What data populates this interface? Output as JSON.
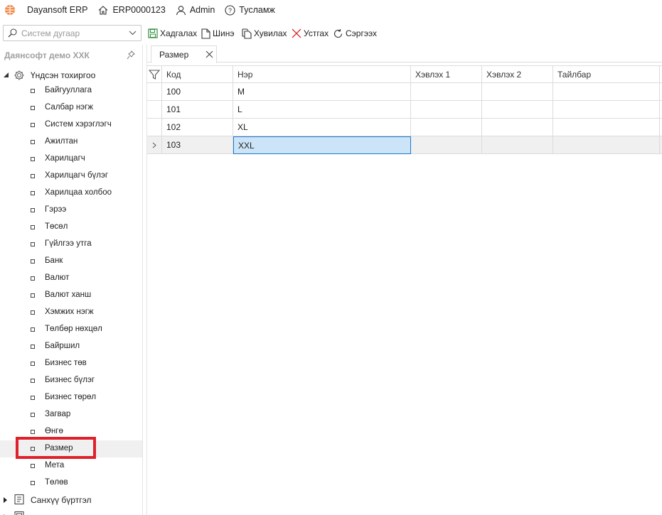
{
  "topbar": {
    "app_name": "Dayansoft ERP",
    "company_code": "ERP0000123",
    "user": "Admin",
    "help": "Тусламж"
  },
  "toolbar": {
    "search_placeholder": "Систем дугаар",
    "save": "Хадгалах",
    "new": "Шинэ",
    "copy": "Хувилах",
    "delete": "Устгах",
    "refresh": "Сэргээх"
  },
  "sidebar": {
    "company": "Даянсофт демо ХХК",
    "root": "Үндсэн тохиргоо",
    "items": [
      {
        "label": "Байгууллага"
      },
      {
        "label": "Салбар нэгж"
      },
      {
        "label": "Систем хэрэглэгч"
      },
      {
        "label": "Ажилтан"
      },
      {
        "label": "Харилцагч"
      },
      {
        "label": "Харилцагч бүлэг"
      },
      {
        "label": "Харилцаа холбоо"
      },
      {
        "label": "Гэрээ"
      },
      {
        "label": "Төсөл"
      },
      {
        "label": "Гүйлгээ утга"
      },
      {
        "label": "Банк"
      },
      {
        "label": "Валют"
      },
      {
        "label": "Валют ханш"
      },
      {
        "label": "Хэмжих нэгж"
      },
      {
        "label": "Төлбөр нөхцөл"
      },
      {
        "label": "Байршил"
      },
      {
        "label": "Бизнес төв"
      },
      {
        "label": "Бизнес бүлэг"
      },
      {
        "label": "Бизнес төрөл"
      },
      {
        "label": "Загвар"
      },
      {
        "label": "Өнгө"
      },
      {
        "label": "Размер"
      },
      {
        "label": "Мета"
      },
      {
        "label": "Төлөв"
      }
    ],
    "selected_index": 21,
    "root2": "Санхүү бүртгэл"
  },
  "tab": {
    "label": "Размер"
  },
  "grid": {
    "columns": [
      "Код",
      "Нэр",
      "Хэвлэх 1",
      "Хэвлэх 2",
      "Тайлбар"
    ],
    "rows": [
      {
        "code": "100",
        "name": "M",
        "print1": "",
        "print2": "",
        "note": ""
      },
      {
        "code": "101",
        "name": "L",
        "print1": "",
        "print2": "",
        "note": ""
      },
      {
        "code": "102",
        "name": "XL",
        "print1": "",
        "print2": "",
        "note": ""
      },
      {
        "code": "103",
        "name": "XXL",
        "print1": "",
        "print2": "",
        "note": ""
      }
    ],
    "current_row": 3
  },
  "colors": {
    "highlight_border": "#e0202a",
    "focused_cell": "#cce4f7",
    "save_icon": "#2e8b3a",
    "delete_icon": "#d9302e",
    "logo": "#f08a4b"
  }
}
